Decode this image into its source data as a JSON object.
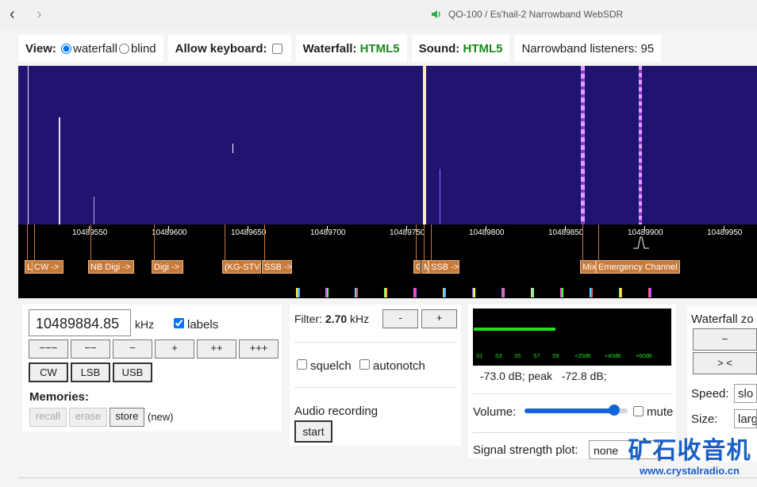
{
  "browser": {
    "back": "‹",
    "forward": "›",
    "title": "QO-100 / Es'hail-2 Narrowband WebSDR"
  },
  "viewbar": {
    "view_label": "View:",
    "waterfall_opt": "waterfall",
    "blind_opt": "blind",
    "keyboard_label": "Allow keyboard:",
    "waterfall_label": "Waterfall:",
    "waterfall_value": "HTML5",
    "sound_label": "Sound:",
    "sound_value": "HTML5",
    "listeners": "Narrowband listeners: 95"
  },
  "scale": {
    "ticks": [
      "10489550",
      "10489600",
      "10489650",
      "10489700",
      "10489750",
      "10489800",
      "10489850",
      "10489900",
      "10489950"
    ],
    "bands": [
      {
        "label": "L"
      },
      {
        "label": "CW ->"
      },
      {
        "label": "NB Digi ->"
      },
      {
        "label": "Digi ->"
      },
      {
        "label": "(KG-STV)"
      },
      {
        "label": "SSB ->"
      },
      {
        "label": "G"
      },
      {
        "label": "M"
      },
      {
        "label": "SSB ->"
      },
      {
        "label": "Mix"
      },
      {
        "label": "Emergency Channel"
      }
    ]
  },
  "tuning": {
    "frequency": "10489884.85",
    "unit": "kHz",
    "labels": "labels",
    "step_buttons": [
      "−−−",
      "−−",
      "−",
      "+",
      "++",
      "+++"
    ],
    "mode_buttons": [
      "CW",
      "LSB",
      "USB"
    ],
    "memories_title": "Memories:",
    "recall": "recall",
    "erase": "erase",
    "store": "store",
    "new_note": "(new)"
  },
  "filter": {
    "label": "Filter:",
    "value": "2.70",
    "unit": "kHz",
    "minus": "-",
    "plus": "+",
    "squelch": "squelch",
    "autonotch": "autonotch",
    "recording_title": "Audio recording",
    "start": "start"
  },
  "meter": {
    "scale": [
      "S1",
      "S3",
      "S5",
      "S7",
      "S9",
      "+20dB",
      "+40dB",
      "+60dB"
    ],
    "readout": "-73.0 dB; peak   -72.8 dB;",
    "volume_label": "Volume:",
    "volume_level": 0.87,
    "mute": "mute",
    "plot_label": "Signal strength plot:",
    "plot_value": "none"
  },
  "zoom": {
    "title": "Waterfall zo",
    "minus": "−",
    "fit": "> <",
    "speed_label": "Speed:",
    "speed_value": "slo",
    "size_label": "Size:",
    "size_value": "larg"
  },
  "watermark": {
    "title": "矿石收音机",
    "url": "www.crystalradio.cn"
  },
  "colors": {
    "waterfall_bg": "#201470",
    "band": "#c87a3a",
    "signal": "#d9a0ff",
    "meter_bar": "#22dd22",
    "link_green": "#1a8a1a"
  }
}
